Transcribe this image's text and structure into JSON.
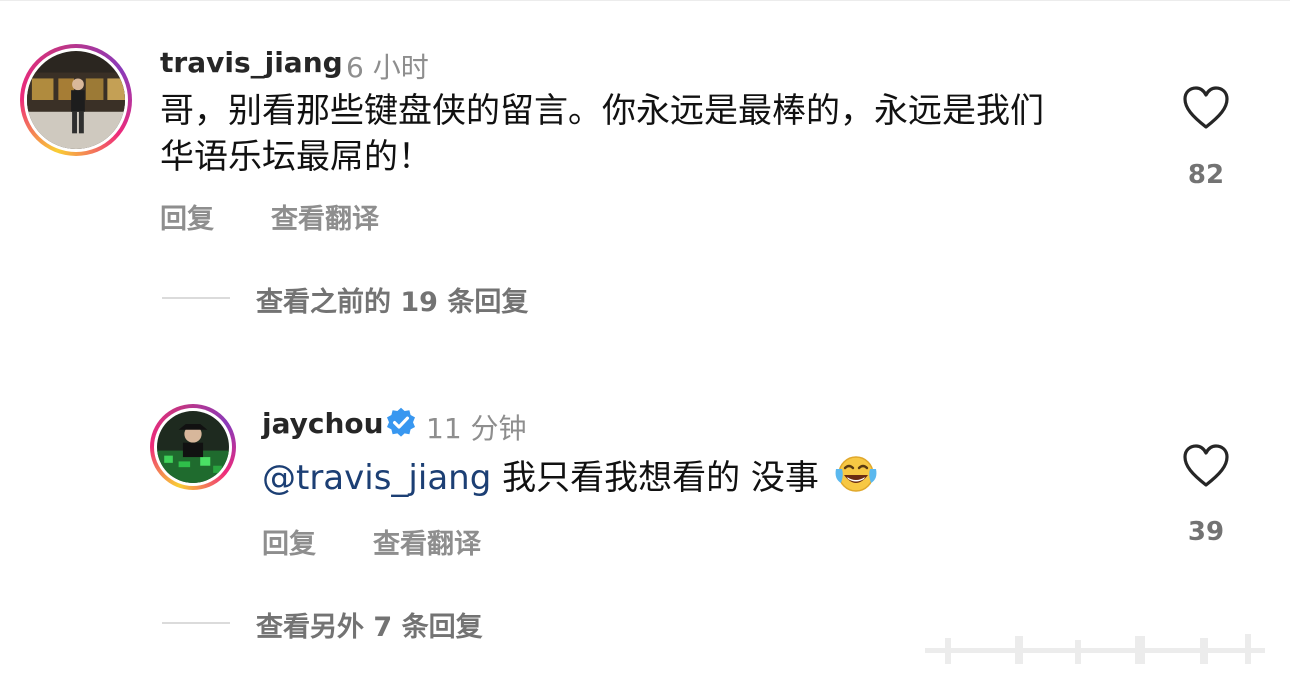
{
  "colors": {
    "mention": "#1c3f74",
    "verified": "#3897f0",
    "muted": "#8e8e8e",
    "ring_start": "#f9ce34",
    "ring_end": "#8a3ab9"
  },
  "comments": [
    {
      "username": "travis_jiang",
      "time": "6 小时",
      "text": "哥，别看那些键盘侠的留言。你永远是最棒的，永远是我们华语乐坛最屌的！",
      "text_line1": "哥，别看那些键盘侠的留言。你永远是最棒的，永远是我们",
      "text_line2": "华语乐坛最屌的！",
      "like_count": "82",
      "reply_label": "回复",
      "translate_label": "查看翻译",
      "view_replies": "查看之前的 19 条回复"
    },
    {
      "username": "jaychou",
      "verified": true,
      "time": "11 分钟",
      "mention": "@travis_jiang",
      "text": "我只看我想看的 没事",
      "emoji": "face-with-tears-of-joy",
      "like_count": "39",
      "reply_label": "回复",
      "translate_label": "查看翻译",
      "view_replies": "查看另外 7 条回复"
    }
  ],
  "icons": {
    "heart": "heart-outline-icon",
    "verified": "verified-badge-icon"
  }
}
